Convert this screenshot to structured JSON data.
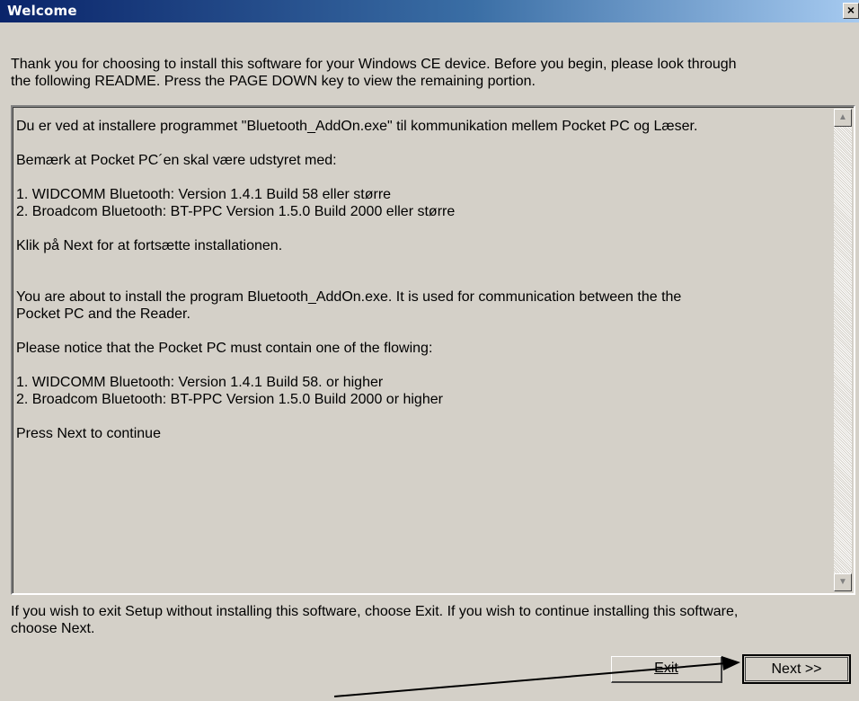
{
  "window": {
    "title": "Welcome",
    "close_glyph": "×"
  },
  "intro": {
    "line1": "Thank you for choosing to install this software for your Windows CE device. Before you begin, please look through",
    "line2": "the following README. Press the PAGE DOWN key to view the remaining portion."
  },
  "readme": {
    "lines": [
      "Du er ved at installere programmet \"Bluetooth_AddOn.exe\" til kommunikation mellem Pocket PC og Læser.",
      "Bemærk at Pocket PC´en skal være udstyret med:",
      "1. WIDCOMM Bluetooth: Version 1.4.1 Build 58 eller større",
      "2. Broadcom Bluetooth: BT-PPC Version 1.5.0 Build 2000 eller større",
      "Klik på Next for at fortsætte installationen.",
      "You are about to install the program Bluetooth_AddOn.exe. It is used for communication between the the",
      "Pocket PC and the Reader.",
      "Please notice that the Pocket PC must contain one of the flowing:",
      "1. WIDCOMM Bluetooth: Version 1.4.1 Build 58. or higher",
      "2. Broadcom Bluetooth: BT-PPC Version 1.5.0 Build 2000 or higher",
      "Press Next to continue"
    ],
    "scroll_up_icon": "▲",
    "scroll_down_icon": "▼"
  },
  "exit_note": {
    "line1": "If you wish to exit Setup without installing this software, choose Exit. If you wish to continue installing this software,",
    "line2": "choose Next."
  },
  "buttons": {
    "exit_label": "Exit",
    "next_label": "Next >>"
  },
  "annotation": {
    "icon": "arrow-pointer-icon",
    "color": "#000000"
  }
}
